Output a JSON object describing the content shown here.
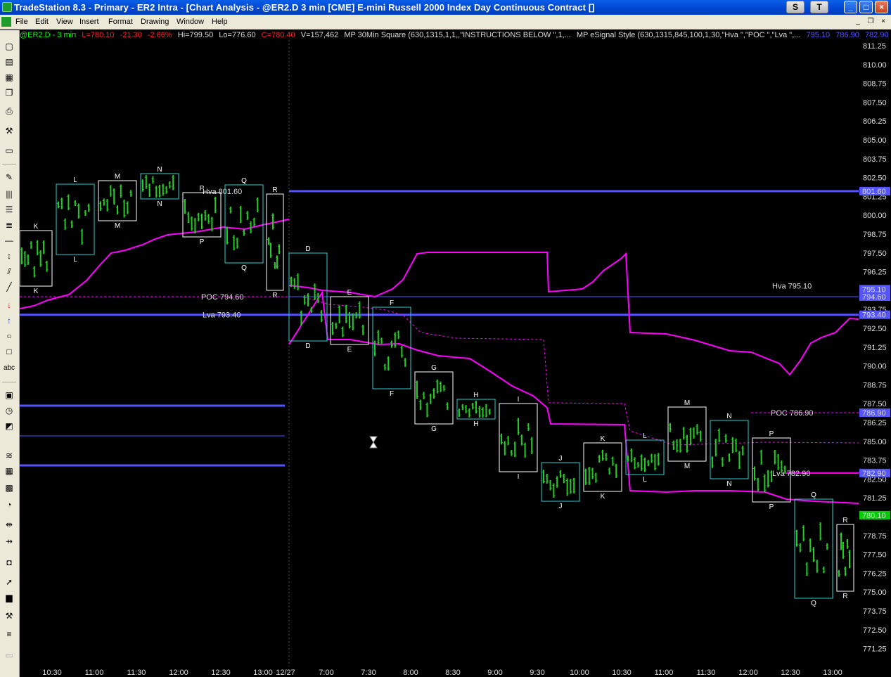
{
  "window": {
    "title": "TradeStation 8.3 - Primary - ER2 Intra - [Chart Analysis - @ER2.D  3 min  [CME] E-mini Russell 2000 Index Day Continuous Contract []",
    "buttons": [
      "S",
      "T",
      "_",
      "□",
      "×"
    ]
  },
  "menu": {
    "items": [
      "File",
      "Edit",
      "View",
      "Insert",
      "Format",
      "Drawing",
      "Window",
      "Help"
    ],
    "mdi_buttons": [
      "_",
      "❐",
      "×"
    ]
  },
  "status_line": {
    "symbol": "@ER2.D - 3 min",
    "last": "L=780.10",
    "net_change": "-21.30",
    "pct_change": "-2.66%",
    "high": "Hi=799.50",
    "low": "Lo=776.60",
    "close": "C=780.40",
    "volume": "V=157,462",
    "indicator1": "MP 30Min Square (630,1315,1,1,,\"INSTRUCTIONS  BELOW   \",1,...",
    "indicator2": "MP eSignal Style (630,1315,845,100,1,30,\"Hva \",\"POC \",\"Lva \",...",
    "values": [
      "795.10",
      "786.90",
      "782.90"
    ]
  },
  "colors": {
    "bars": "#22cc22",
    "vwap": "#ff00ff",
    "level_line": "#5555ff",
    "profile_white": "#ffffff",
    "profile_cyan": "#33cccc",
    "positive_text": "#00ff00",
    "negative_text": "#ff2222",
    "axis_text": "#dddddd"
  },
  "chart_data": {
    "type": "candlestick",
    "y_ticks": [
      "811.25",
      "810.00",
      "808.75",
      "807.50",
      "806.25",
      "805.00",
      "803.75",
      "802.50",
      "801.25",
      "800.00",
      "798.75",
      "797.50",
      "796.25",
      "795.00",
      "793.75",
      "792.50",
      "791.25",
      "790.00",
      "788.75",
      "787.50",
      "786.25",
      "785.00",
      "783.75",
      "782.50",
      "781.25",
      "780.00",
      "778.75",
      "777.50",
      "776.25",
      "775.00",
      "773.75",
      "772.50",
      "771.25"
    ],
    "x_ticks": [
      "10:30",
      "11:00",
      "11:30",
      "12:00",
      "12:30",
      "13:00",
      "12/27",
      "7:00",
      "7:30",
      "8:00",
      "8:30",
      "9:00",
      "9:30",
      "10:00",
      "10:30",
      "11:00",
      "11:30",
      "12:00",
      "12:30",
      "13:00"
    ],
    "price_tags": [
      {
        "label": "801.60",
        "price": 801.6,
        "color": "#5555ff"
      },
      {
        "label": "795.10",
        "price": 795.1,
        "color": "#5555ff"
      },
      {
        "label": "794.60",
        "price": 794.6,
        "color": "#5555ff"
      },
      {
        "label": "793.40",
        "price": 793.4,
        "color": "#5555ff"
      },
      {
        "label": "786.90",
        "price": 786.9,
        "color": "#5555ff"
      },
      {
        "label": "782.90",
        "price": 782.9,
        "color": "#5555ff"
      },
      {
        "label": "780.10",
        "price": 780.1,
        "color": "#00cc00"
      }
    ],
    "levels_prior_day": [
      {
        "label": "Hva 801.60",
        "price": 801.6
      },
      {
        "label": "POC 794.60",
        "price": 794.6
      },
      {
        "label": "Lva 793.40",
        "price": 793.4
      }
    ],
    "levels_today": [
      {
        "label": "Hva 795.10",
        "price": 795.1
      },
      {
        "label": "POC 786.90",
        "price": 786.9
      },
      {
        "label": "Lva 782.90",
        "price": 782.9
      }
    ],
    "profile_letters_prior": [
      "K",
      "L",
      "M",
      "N",
      "P",
      "Q",
      "R"
    ],
    "profile_letters_today": [
      "D",
      "E",
      "F",
      "G",
      "H",
      "I",
      "J",
      "K",
      "L",
      "M",
      "N",
      "P",
      "Q",
      "R"
    ]
  }
}
